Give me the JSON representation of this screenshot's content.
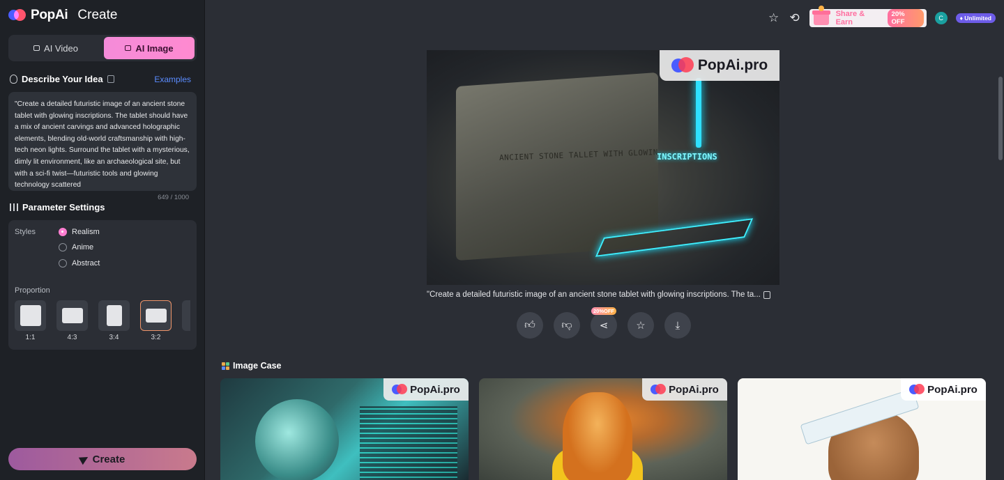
{
  "brand": {
    "name": "PopAi",
    "section": "Create"
  },
  "mode_toggle": {
    "video_label": "AI Video",
    "image_label": "AI Image",
    "active": "image"
  },
  "describe": {
    "title": "Describe Your Idea",
    "examples_label": "Examples",
    "prompt_text": "\"Create a detailed futuristic image of an ancient stone tablet with glowing inscriptions. The tablet should have a mix of ancient carvings and advanced holographic elements, blending old-world craftsmanship with high-tech neon lights. Surround the tablet with a mysterious, dimly lit environment, like an archaeological site, but with a sci-fi twist—futuristic tools and glowing technology scattered",
    "char_count": "649 / 1000"
  },
  "parameters": {
    "title": "Parameter Settings",
    "styles_label": "Styles",
    "styles": [
      {
        "label": "Realism",
        "selected": true
      },
      {
        "label": "Anime",
        "selected": false
      },
      {
        "label": "Abstract",
        "selected": false
      }
    ],
    "proportion_label": "Proportion",
    "proportions": [
      {
        "label": "1:1",
        "selected": false
      },
      {
        "label": "4:3",
        "selected": false
      },
      {
        "label": "3:4",
        "selected": false
      },
      {
        "label": "3:2",
        "selected": true
      }
    ]
  },
  "create_button": {
    "label": "Create"
  },
  "topbar": {
    "share_label": "Share & Earn",
    "off_badge": "20% OFF",
    "avatar_initial": "C",
    "plan_badge": "Unlimited"
  },
  "result": {
    "watermark": "PopAi.pro",
    "stone_text": "ANCIENT STONE TALLET WITH GLOWIN",
    "neon_text": "INSCRIPTIONS",
    "caption": "\"Create a detailed futuristic image of an ancient stone tablet with glowing inscriptions. The ta...",
    "share_badge": "20%OFF"
  },
  "image_case": {
    "title": "Image Case",
    "watermark": "PopAi.pro"
  },
  "colors": {
    "accent_pink": "#ff7fd1",
    "link_blue": "#5b8cff",
    "neon": "#3ff0ff"
  }
}
